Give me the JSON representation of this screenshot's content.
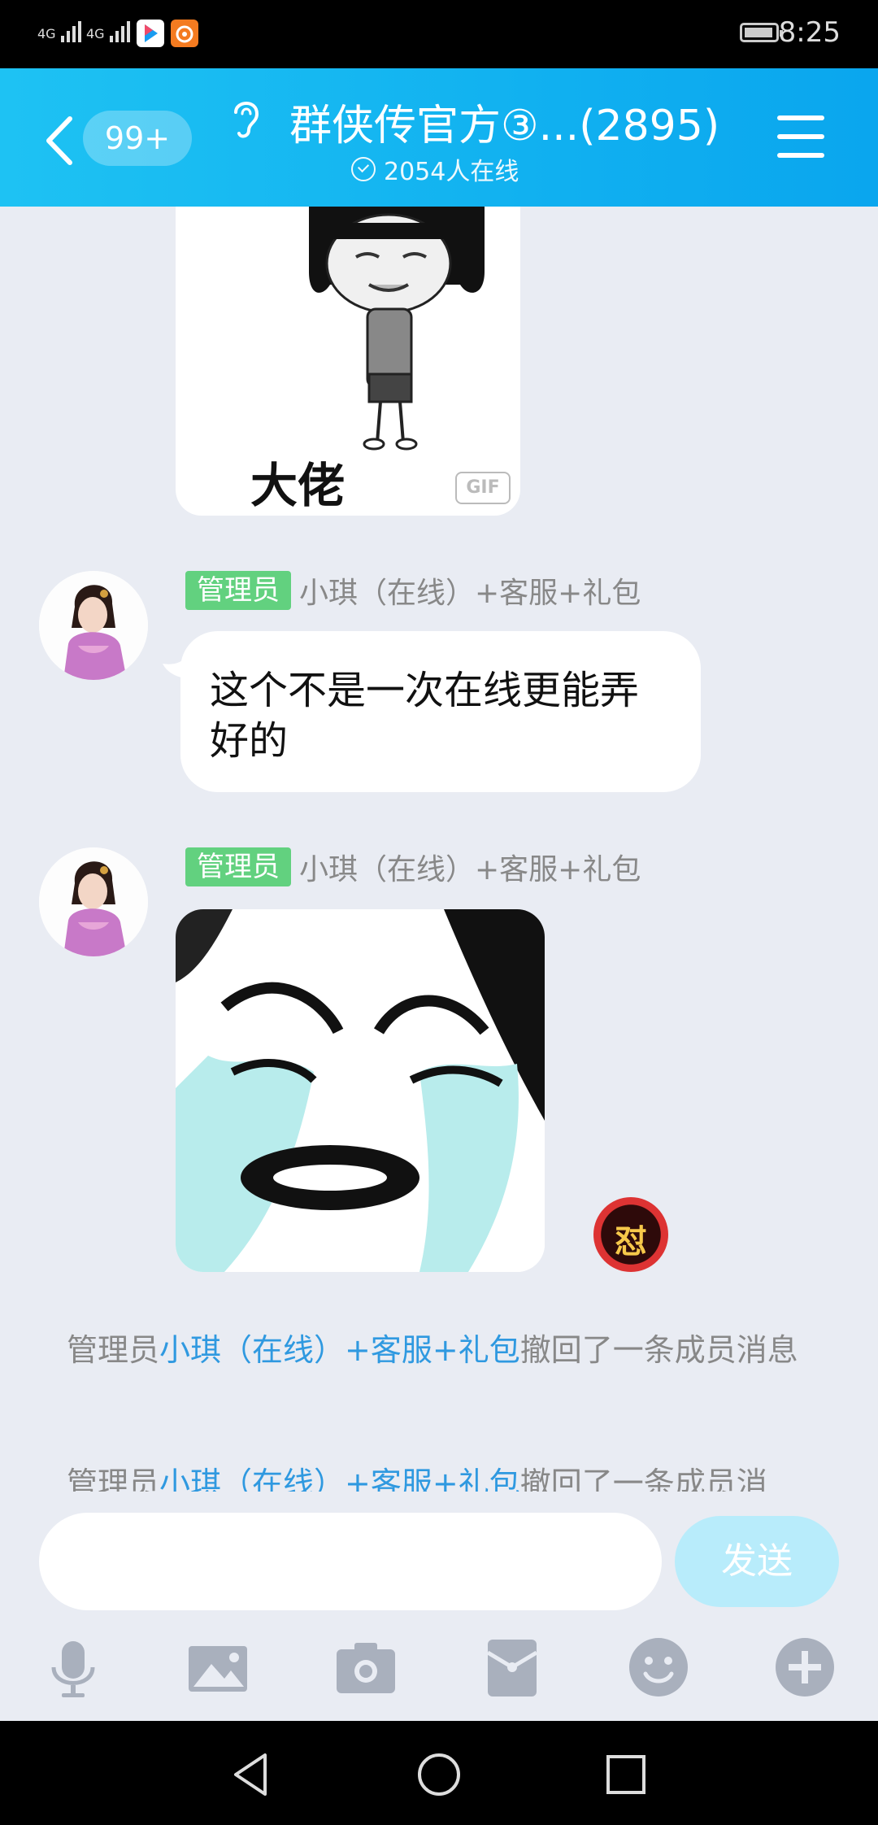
{
  "status_bar": {
    "signal_1": "4G",
    "signal_2": "4G",
    "time": "8:25"
  },
  "header": {
    "unread_count": "99+",
    "group_title": "群侠传官方③...(2895)",
    "online_text": "2054人在线"
  },
  "messages": {
    "sticker_top_caption": "大佬",
    "gif_label": "GIF",
    "msg1": {
      "badge": "管理员",
      "sender": "小琪（在线）+客服+礼包",
      "text": "这个不是一次在线更能弄好的"
    },
    "msg2": {
      "badge": "管理员",
      "sender": "小琪（在线）+客服+礼包"
    },
    "medal_text": "怼",
    "system1": {
      "prefix": "管理员",
      "name": "小琪（在线）+客服+礼包",
      "suffix": "撤回了一条成员消息"
    },
    "system2": {
      "prefix": "管理员",
      "name": "小琪（在线）+客服+礼包",
      "suffix": "撤回了一条成员消"
    }
  },
  "input": {
    "placeholder": "",
    "send_label": "发送"
  },
  "colors": {
    "header_start": "#1ec2f3",
    "header_end": "#0aa6ee",
    "admin_badge": "#62d17f",
    "link_name": "#2f99e0",
    "send_disabled": "#b8ecfb"
  },
  "toolbar_icons": [
    "microphone-icon",
    "image-icon",
    "camera-icon",
    "red-packet-icon",
    "emoji-icon",
    "plus-icon"
  ]
}
